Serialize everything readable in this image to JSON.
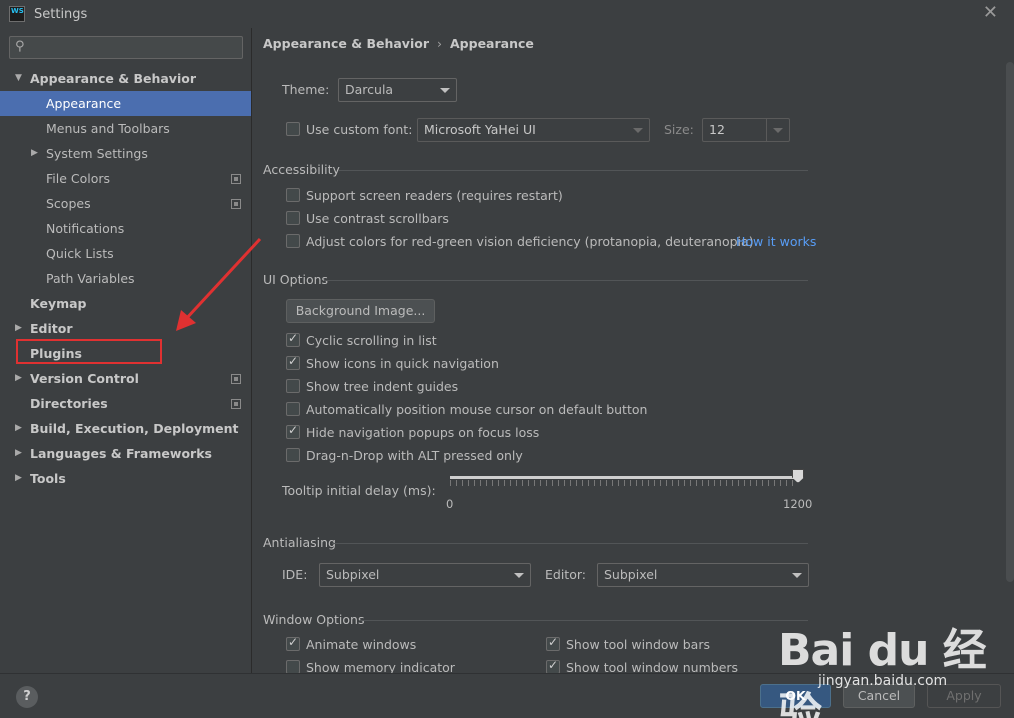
{
  "window": {
    "app_icon_line1": "WS",
    "title": "Settings",
    "close_glyph": "✕"
  },
  "search": {
    "placeholder": "",
    "value": ""
  },
  "tree": [
    {
      "label": "Appearance & Behavior",
      "level": 0,
      "bold": true,
      "arrow": "expanded",
      "selected": false,
      "copy_icon": false
    },
    {
      "label": "Appearance",
      "level": 1,
      "bold": false,
      "arrow": "none",
      "selected": true,
      "copy_icon": false
    },
    {
      "label": "Menus and Toolbars",
      "level": 1,
      "bold": false,
      "arrow": "none",
      "selected": false,
      "copy_icon": false
    },
    {
      "label": "System Settings",
      "level": 1,
      "bold": false,
      "arrow": "collapsed",
      "selected": false,
      "copy_icon": false
    },
    {
      "label": "File Colors",
      "level": 1,
      "bold": false,
      "arrow": "none",
      "selected": false,
      "copy_icon": true
    },
    {
      "label": "Scopes",
      "level": 1,
      "bold": false,
      "arrow": "none",
      "selected": false,
      "copy_icon": true
    },
    {
      "label": "Notifications",
      "level": 1,
      "bold": false,
      "arrow": "none",
      "selected": false,
      "copy_icon": false
    },
    {
      "label": "Quick Lists",
      "level": 1,
      "bold": false,
      "arrow": "none",
      "selected": false,
      "copy_icon": false
    },
    {
      "label": "Path Variables",
      "level": 1,
      "bold": false,
      "arrow": "none",
      "selected": false,
      "copy_icon": false
    },
    {
      "label": "Keymap",
      "level": 0,
      "bold": true,
      "arrow": "none",
      "selected": false,
      "copy_icon": false
    },
    {
      "label": "Editor",
      "level": 0,
      "bold": true,
      "arrow": "collapsed",
      "selected": false,
      "copy_icon": false
    },
    {
      "label": "Plugins",
      "level": 0,
      "bold": true,
      "arrow": "none",
      "selected": false,
      "copy_icon": false
    },
    {
      "label": "Version Control",
      "level": 0,
      "bold": true,
      "arrow": "collapsed",
      "selected": false,
      "copy_icon": true
    },
    {
      "label": "Directories",
      "level": 0,
      "bold": true,
      "arrow": "none",
      "selected": false,
      "copy_icon": true
    },
    {
      "label": "Build, Execution, Deployment",
      "level": 0,
      "bold": true,
      "arrow": "collapsed",
      "selected": false,
      "copy_icon": false
    },
    {
      "label": "Languages & Frameworks",
      "level": 0,
      "bold": true,
      "arrow": "collapsed",
      "selected": false,
      "copy_icon": false
    },
    {
      "label": "Tools",
      "level": 0,
      "bold": true,
      "arrow": "collapsed",
      "selected": false,
      "copy_icon": false
    }
  ],
  "breadcrumb": {
    "parent": "Appearance & Behavior",
    "separator": "›",
    "current": "Appearance"
  },
  "theme": {
    "label": "Theme:",
    "value": "Darcula"
  },
  "custom_font": {
    "label": "Use custom font:",
    "checked": false,
    "font_value": "Microsoft YaHei UI",
    "size_label": "Size:",
    "size_value": "12"
  },
  "accessibility": {
    "title": "Accessibility",
    "options": [
      {
        "label": "Support screen readers (requires restart)",
        "checked": false
      },
      {
        "label": "Use contrast scrollbars",
        "checked": false
      },
      {
        "label": "Adjust colors for red-green vision deficiency (protanopia, deuteranopia)",
        "checked": false
      }
    ],
    "link": "How it works"
  },
  "ui_options": {
    "title": "UI Options",
    "bg_button": "Background Image...",
    "options": [
      {
        "label": "Cyclic scrolling in list",
        "checked": true
      },
      {
        "label": "Show icons in quick navigation",
        "checked": true
      },
      {
        "label": "Show tree indent guides",
        "checked": false
      },
      {
        "label": "Automatically position mouse cursor on default button",
        "checked": false
      },
      {
        "label": "Hide navigation popups on focus loss",
        "checked": true
      },
      {
        "label": "Drag-n-Drop with ALT pressed only",
        "checked": false
      }
    ],
    "tooltip_label": "Tooltip initial delay (ms):",
    "slider_min": "0",
    "slider_max": "1200",
    "slider_value": 1200
  },
  "antialiasing": {
    "title": "Antialiasing",
    "ide_label": "IDE:",
    "ide_value": "Subpixel",
    "editor_label": "Editor:",
    "editor_value": "Subpixel"
  },
  "window_options": {
    "title": "Window Options",
    "left": [
      {
        "label": "Animate windows",
        "checked": true
      },
      {
        "label": "Show memory indicator",
        "checked": false
      }
    ],
    "right": [
      {
        "label": "Show tool window bars",
        "checked": true
      },
      {
        "label": "Show tool window numbers",
        "checked": true
      }
    ]
  },
  "footer": {
    "help": "?",
    "ok": "OK",
    "cancel": "Cancel",
    "apply": "Apply"
  },
  "watermark": {
    "brand": "Bai du 经验",
    "url": "jingyan.baidu.com"
  },
  "colors": {
    "selection": "#4b6eaf",
    "link": "#589df6",
    "annotation": "#e03131",
    "background": "#3c3f41"
  }
}
